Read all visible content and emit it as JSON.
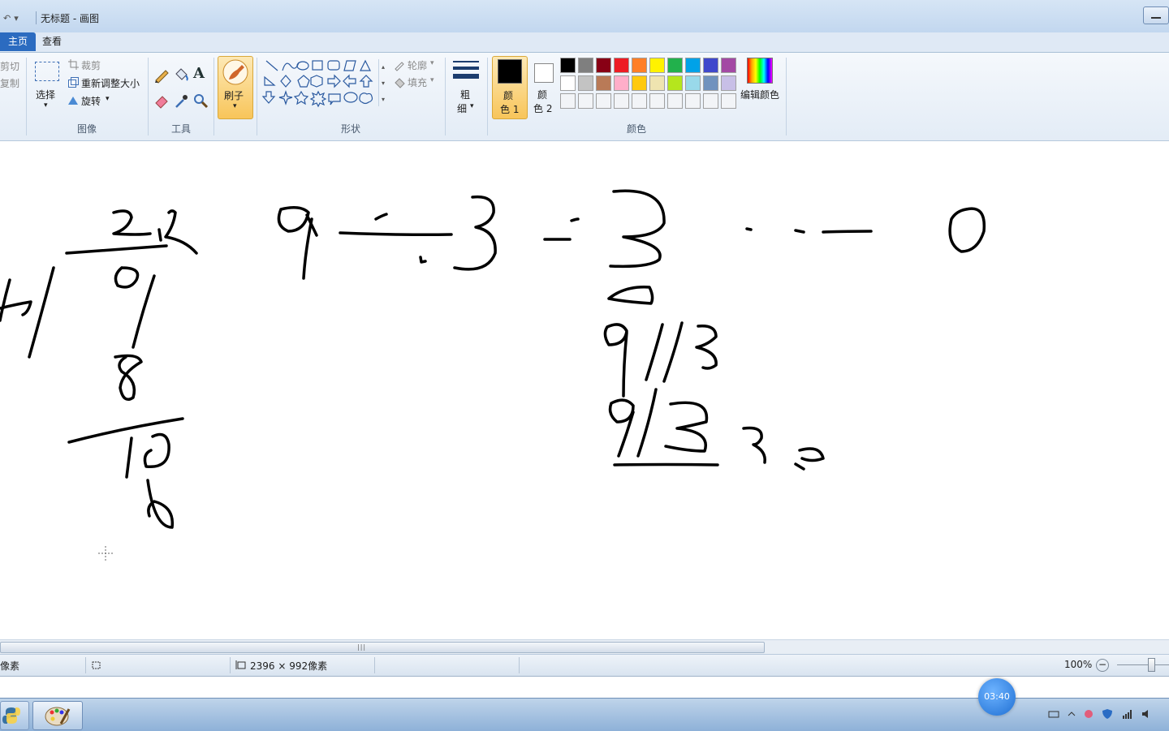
{
  "window": {
    "title": "无标题 - 画图"
  },
  "tabs": [
    {
      "label": "主页"
    },
    {
      "label": "查看"
    }
  ],
  "clipboard": {
    "cut": "剪切",
    "copy": "复制"
  },
  "image_group": {
    "label": "图像",
    "select": "选择",
    "crop": "裁剪",
    "resize": "重新调整大小",
    "rotate": "旋转"
  },
  "tools_group": {
    "label": "工具"
  },
  "brush": {
    "label": "刷子"
  },
  "shapes_group": {
    "label": "形状",
    "outline": "轮廓",
    "fill": "填充"
  },
  "size": {
    "line1": "粗",
    "line2": "细"
  },
  "colors_group": {
    "label": "颜色",
    "color1": {
      "line1": "颜",
      "line2": "色 1",
      "value": "#000000"
    },
    "color2": {
      "line1": "颜",
      "line2": "色 2",
      "value": "#ffffff"
    },
    "edit_colors": "编辑颜色",
    "palette_row1": [
      "#000000",
      "#7f7f7f",
      "#880015",
      "#ed1c24",
      "#ff7f27",
      "#fff200",
      "#22b14c",
      "#00a2e8",
      "#3f48cc",
      "#a349a4"
    ],
    "palette_row2": [
      "#ffffff",
      "#c3c3c3",
      "#b97a57",
      "#ffaec9",
      "#ffc90e",
      "#efe4b0",
      "#b5e61d",
      "#99d9ea",
      "#7092be",
      "#c8bfe7"
    ]
  },
  "status": {
    "pixel_unit": "像素",
    "dimensions": "2396 × 992像素",
    "zoom": "100%"
  },
  "timer": {
    "value": "03:40"
  },
  "icons": [
    "undo-icon",
    "select-icon",
    "crop-icon",
    "resize-icon",
    "rotate-icon",
    "pencil-icon",
    "fill-bucket-icon",
    "text-icon",
    "eraser-icon",
    "color-picker-icon",
    "magnifier-icon",
    "brush-icon",
    "outline-icon",
    "fill-icon",
    "size-icon",
    "edit-colors-icon",
    "python-icon",
    "paint-icon"
  ]
}
